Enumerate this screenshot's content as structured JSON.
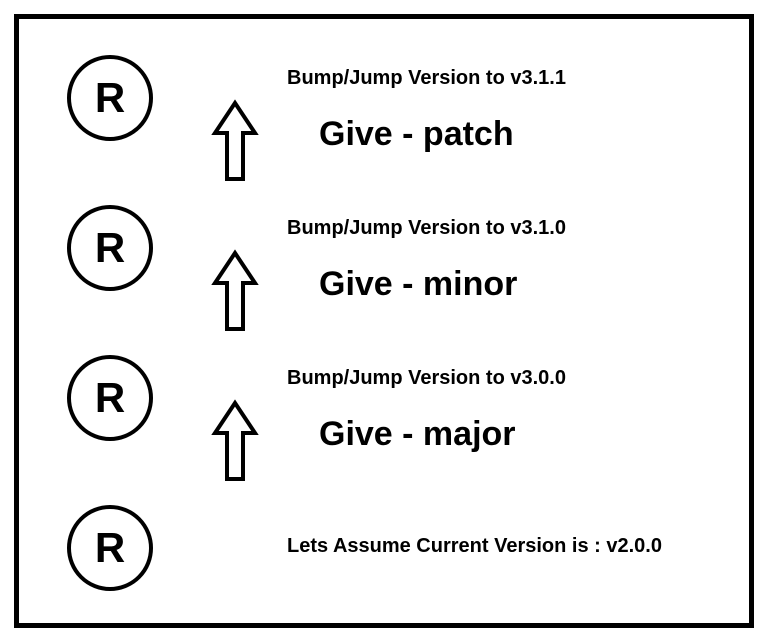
{
  "nodes": {
    "letter": "R"
  },
  "rows": [
    {
      "bump": "Bump/Jump Version to v3.1.1",
      "give": "Give - patch"
    },
    {
      "bump": "Bump/Jump Version to v3.1.0",
      "give": "Give - minor"
    },
    {
      "bump": "Bump/Jump Version to v3.0.0",
      "give": "Give - major"
    }
  ],
  "assume": "Lets Assume Current Version is : v2.0.0"
}
